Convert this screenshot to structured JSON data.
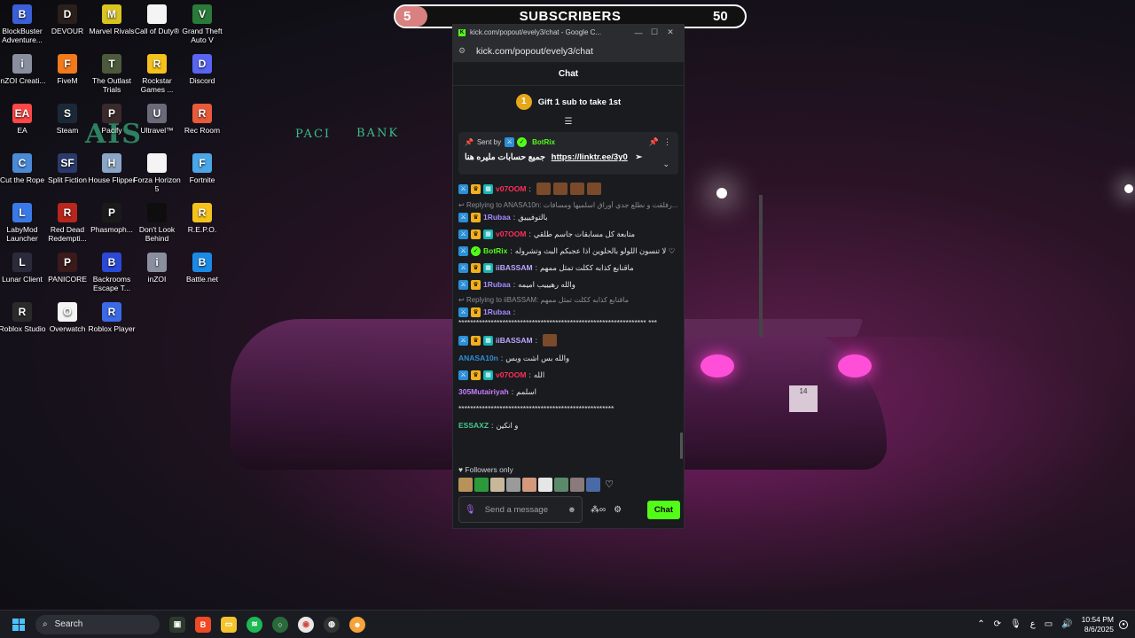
{
  "subscribers": {
    "count_left": "5",
    "title": "SUBSCRIBERS",
    "count_right": "50"
  },
  "wallpaper": {
    "sign_ais": "AIS",
    "sign_pacific": "PACI",
    "sign_bank": "BANK",
    "plate": "14"
  },
  "desktop_icons": [
    {
      "label": "BlockBuster Adventure...",
      "color": "#3a5fd6",
      "glyph": "B"
    },
    {
      "label": "DEVOUR",
      "color": "#2a1f1a",
      "glyph": "D"
    },
    {
      "label": "Marvel Rivals",
      "color": "#d9c421",
      "glyph": "M"
    },
    {
      "label": "Call of Duty®",
      "color": "#f4f4f4",
      "glyph": ""
    },
    {
      "label": "Grand Theft Auto V",
      "color": "#2a7a3a",
      "glyph": "V"
    },
    {
      "label": "inZOI Creati...",
      "color": "#8a8fa0",
      "glyph": "i"
    },
    {
      "label": "FiveM",
      "color": "#f07a1c",
      "glyph": "F"
    },
    {
      "label": "The Outlast Trials",
      "color": "#4a5a3a",
      "glyph": "T"
    },
    {
      "label": "Rockstar Games ...",
      "color": "#f4c21a",
      "glyph": "R"
    },
    {
      "label": "Discord",
      "color": "#5865f2",
      "glyph": "D"
    },
    {
      "label": "EA",
      "color": "#ff4747",
      "glyph": "EA"
    },
    {
      "label": "Steam",
      "color": "#1b2838",
      "glyph": "S"
    },
    {
      "label": "Pacify",
      "color": "#3a2a2a",
      "glyph": "P"
    },
    {
      "label": "Ultravel™",
      "color": "#6a6a7a",
      "glyph": "U"
    },
    {
      "label": "Rec Room",
      "color": "#e85a3a",
      "glyph": "R"
    },
    {
      "label": "Cut the Rope",
      "color": "#4a8ad6",
      "glyph": "C"
    },
    {
      "label": "Split Fiction",
      "color": "#2a3a6a",
      "glyph": "SF"
    },
    {
      "label": "House Flipper",
      "color": "#8aa6c6",
      "glyph": "H"
    },
    {
      "label": "Forza Horizon 5",
      "color": "#f4f4f4",
      "glyph": ""
    },
    {
      "label": "Fortnite",
      "color": "#4aa6e6",
      "glyph": "F"
    },
    {
      "label": "LabyMod Launcher",
      "color": "#3a7ae6",
      "glyph": "L"
    },
    {
      "label": "Red Dead Redempti...",
      "color": "#b8261c",
      "glyph": "R"
    },
    {
      "label": "Phasmoph...",
      "color": "#1a1a1a",
      "glyph": "P"
    },
    {
      "label": "Don't Look Behind",
      "color": "#0e0e0e",
      "glyph": ""
    },
    {
      "label": "R.E.P.O.",
      "color": "#f4c21a",
      "glyph": "R"
    },
    {
      "label": "Lunar Client",
      "color": "#2a2a3a",
      "glyph": "L"
    },
    {
      "label": "PANICORE",
      "color": "#3a1a1a",
      "glyph": "P"
    },
    {
      "label": "Backrooms Escape T...",
      "color": "#2a4ad6",
      "glyph": "B"
    },
    {
      "label": "inZOI",
      "color": "#8a8fa0",
      "glyph": "i"
    },
    {
      "label": "Battle.net",
      "color": "#1a8ae6",
      "glyph": "B"
    },
    {
      "label": "Roblox Studio",
      "color": "#2a2a2a",
      "glyph": "R"
    },
    {
      "label": "Overwatch",
      "color": "#f4f4f4",
      "glyph": "O"
    },
    {
      "label": "Roblox Player",
      "color": "#3a6ae6",
      "glyph": "R"
    }
  ],
  "browser": {
    "title": "kick.com/popout/evely3/chat - Google C...",
    "url": "kick.com/popout/evely3/chat",
    "chat_header": "Chat",
    "gift_text": "Gift 1 sub to take 1st",
    "gift_coin": "1"
  },
  "pinned": {
    "sent_by": "Sent by",
    "bot_name": "BotRix",
    "message": "جميع حسابات مليره هنا",
    "link": "https://linktr.ee/3y0"
  },
  "messages": [
    {
      "type": "msg",
      "badges": [
        "blue",
        "gold",
        "teal"
      ],
      "user": "v07OOM",
      "color": "#ff2f5a",
      "text": "",
      "emotes": 4
    },
    {
      "type": "reply",
      "text": "Replying to ANASA10n: رفلقت و نطلع جدي أوراق اسلميها ومسافات..."
    },
    {
      "type": "msg",
      "badges": [
        "blue",
        "gold"
      ],
      "user": "1Rubaa",
      "color": "#a78bff",
      "text": "بالتوفيييق"
    },
    {
      "type": "msg",
      "badges": [
        "blue",
        "gold",
        "teal"
      ],
      "user": "v07OOM",
      "color": "#ff2f5a",
      "text": "متابعة كل مسابقات جاسم طلقي"
    },
    {
      "type": "msg",
      "badges": [
        "blue",
        "green"
      ],
      "user": "BotRix",
      "color": "#53fc18",
      "text": "لا تنسون اللولو بالحلوين اذا عجبكم البث وتشروله ♡"
    },
    {
      "type": "msg",
      "badges": [
        "blue",
        "gold",
        "teal"
      ],
      "user": "iiBASSAM",
      "color": "#bda6ff",
      "text": "ماقنابع كذابه ككلت تمثل ممهم"
    },
    {
      "type": "msg",
      "badges": [
        "blue",
        "gold"
      ],
      "user": "1Rubaa",
      "color": "#a78bff",
      "text": "والله رهيييب اميمه"
    },
    {
      "type": "reply",
      "text": "Replying to iiBASSAM: ماقنابع كذابه ككلت تمثل ممهم"
    },
    {
      "type": "msg",
      "badges": [
        "blue",
        "gold"
      ],
      "user": "1Rubaa",
      "color": "#a78bff",
      "text": "**************************************************************** ***"
    },
    {
      "type": "msg",
      "badges": [
        "blue",
        "gold",
        "teal"
      ],
      "user": "iiBASSAM",
      "color": "#bda6ff",
      "text": "",
      "emotes": 1
    },
    {
      "type": "msg",
      "badges": [],
      "user": "ANASA10n",
      "color": "#2f8fd6",
      "text": "والله بس اشت وبس"
    },
    {
      "type": "msg",
      "badges": [
        "blue",
        "gold",
        "teal"
      ],
      "user": "v07OOM",
      "color": "#ff2f5a",
      "text": "الله"
    },
    {
      "type": "msg",
      "badges": [],
      "user": "305Mutairiyah",
      "color": "#c77dff",
      "text": "اسلمم"
    },
    {
      "type": "msg",
      "badges": [],
      "user": "",
      "color": "#e6e6e6",
      "text": "*****************************************************"
    },
    {
      "type": "msg",
      "badges": [],
      "user": "ESSAXZ",
      "color": "#48c78e",
      "text": "و انكين"
    }
  ],
  "footer": {
    "followers_only": "Followers only",
    "placeholder": "Send a message",
    "chat_button": "Chat"
  },
  "taskbar": {
    "search": "Search",
    "time": "10:54 PM",
    "date": "8/6/2025",
    "lang": "ع"
  }
}
